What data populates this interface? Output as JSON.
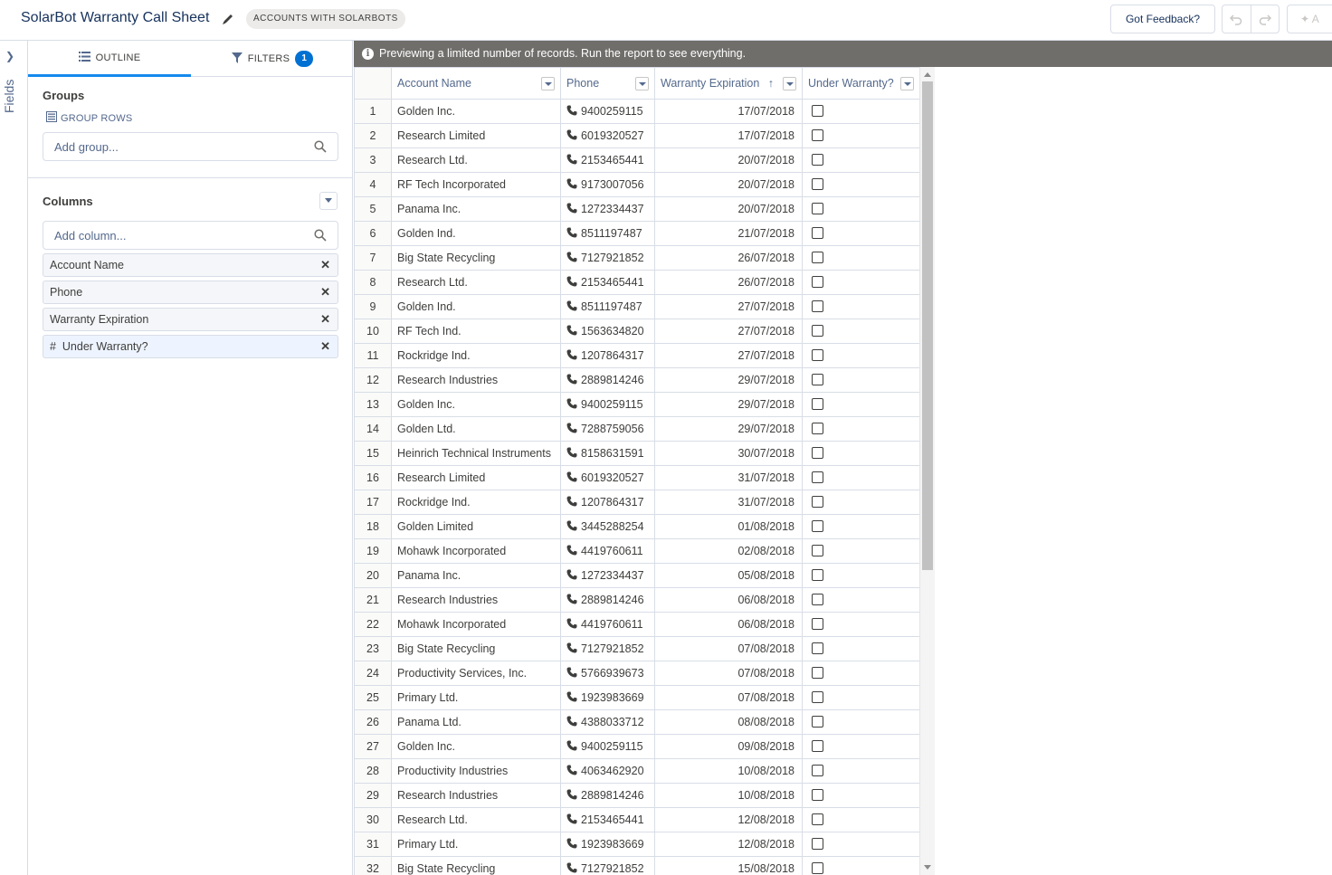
{
  "header": {
    "title": "SolarBot Warranty Call Sheet",
    "report_type": "ACCOUNTS WITH SOLARBOTS",
    "feedback_label": "Got Feedback?",
    "add_label": "A"
  },
  "fields_strip": {
    "label": "Fields"
  },
  "panel": {
    "tabs": [
      {
        "label": "OUTLINE",
        "icon": "list-icon"
      },
      {
        "label": "FILTERS",
        "icon": "filter-icon",
        "count": "1"
      }
    ],
    "groups": {
      "title": "Groups",
      "group_rows_label": "GROUP ROWS",
      "add_placeholder": "Add group..."
    },
    "columns": {
      "title": "Columns",
      "add_placeholder": "Add column...",
      "items": [
        {
          "label": "Account Name"
        },
        {
          "label": "Phone"
        },
        {
          "label": "Warranty Expiration"
        },
        {
          "label": "#  Under Warranty?"
        }
      ]
    }
  },
  "banner": {
    "text": "Previewing a limited number of records. Run the report to see everything."
  },
  "table": {
    "columns": [
      "Account Name",
      "Phone",
      "Warranty Expiration",
      "Under Warranty?"
    ],
    "rows": [
      {
        "n": "1",
        "account": "Golden Inc.",
        "phone": "9400259115",
        "date": "17/07/2018"
      },
      {
        "n": "2",
        "account": "Research Limited",
        "phone": "6019320527",
        "date": "17/07/2018"
      },
      {
        "n": "3",
        "account": "Research Ltd.",
        "phone": "2153465441",
        "date": "20/07/2018"
      },
      {
        "n": "4",
        "account": "RF Tech Incorporated",
        "phone": "9173007056",
        "date": "20/07/2018"
      },
      {
        "n": "5",
        "account": "Panama Inc.",
        "phone": "1272334437",
        "date": "20/07/2018"
      },
      {
        "n": "6",
        "account": "Golden Ind.",
        "phone": "8511197487",
        "date": "21/07/2018"
      },
      {
        "n": "7",
        "account": "Big State Recycling",
        "phone": "7127921852",
        "date": "26/07/2018"
      },
      {
        "n": "8",
        "account": "Research Ltd.",
        "phone": "2153465441",
        "date": "26/07/2018"
      },
      {
        "n": "9",
        "account": "Golden Ind.",
        "phone": "8511197487",
        "date": "27/07/2018"
      },
      {
        "n": "10",
        "account": "RF Tech Ind.",
        "phone": "1563634820",
        "date": "27/07/2018"
      },
      {
        "n": "11",
        "account": "Rockridge Ind.",
        "phone": "1207864317",
        "date": "27/07/2018"
      },
      {
        "n": "12",
        "account": "Research Industries",
        "phone": "2889814246",
        "date": "29/07/2018"
      },
      {
        "n": "13",
        "account": "Golden Inc.",
        "phone": "9400259115",
        "date": "29/07/2018"
      },
      {
        "n": "14",
        "account": "Golden Ltd.",
        "phone": "7288759056",
        "date": "29/07/2018"
      },
      {
        "n": "15",
        "account": "Heinrich Technical Instruments",
        "phone": "8158631591",
        "date": "30/07/2018"
      },
      {
        "n": "16",
        "account": "Research Limited",
        "phone": "6019320527",
        "date": "31/07/2018"
      },
      {
        "n": "17",
        "account": "Rockridge Ind.",
        "phone": "1207864317",
        "date": "31/07/2018"
      },
      {
        "n": "18",
        "account": "Golden Limited",
        "phone": "3445288254",
        "date": "01/08/2018"
      },
      {
        "n": "19",
        "account": "Mohawk Incorporated",
        "phone": "4419760611",
        "date": "02/08/2018"
      },
      {
        "n": "20",
        "account": "Panama Inc.",
        "phone": "1272334437",
        "date": "05/08/2018"
      },
      {
        "n": "21",
        "account": "Research Industries",
        "phone": "2889814246",
        "date": "06/08/2018"
      },
      {
        "n": "22",
        "account": "Mohawk Incorporated",
        "phone": "4419760611",
        "date": "06/08/2018"
      },
      {
        "n": "23",
        "account": "Big State Recycling",
        "phone": "7127921852",
        "date": "07/08/2018"
      },
      {
        "n": "24",
        "account": "Productivity Services, Inc.",
        "phone": "5766939673",
        "date": "07/08/2018"
      },
      {
        "n": "25",
        "account": "Primary Ltd.",
        "phone": "1923983669",
        "date": "07/08/2018"
      },
      {
        "n": "26",
        "account": "Panama Ltd.",
        "phone": "4388033712",
        "date": "08/08/2018"
      },
      {
        "n": "27",
        "account": "Golden Inc.",
        "phone": "9400259115",
        "date": "09/08/2018"
      },
      {
        "n": "28",
        "account": "Productivity Industries",
        "phone": "4063462920",
        "date": "10/08/2018"
      },
      {
        "n": "29",
        "account": "Research Industries",
        "phone": "2889814246",
        "date": "10/08/2018"
      },
      {
        "n": "30",
        "account": "Research Ltd.",
        "phone": "2153465441",
        "date": "12/08/2018"
      },
      {
        "n": "31",
        "account": "Primary Ltd.",
        "phone": "1923983669",
        "date": "12/08/2018"
      },
      {
        "n": "32",
        "account": "Big State Recycling",
        "phone": "7127921852",
        "date": "15/08/2018"
      }
    ]
  },
  "colors": {
    "accent": "#1589ee",
    "badge": "#0070d2",
    "banner": "#706e6b"
  }
}
